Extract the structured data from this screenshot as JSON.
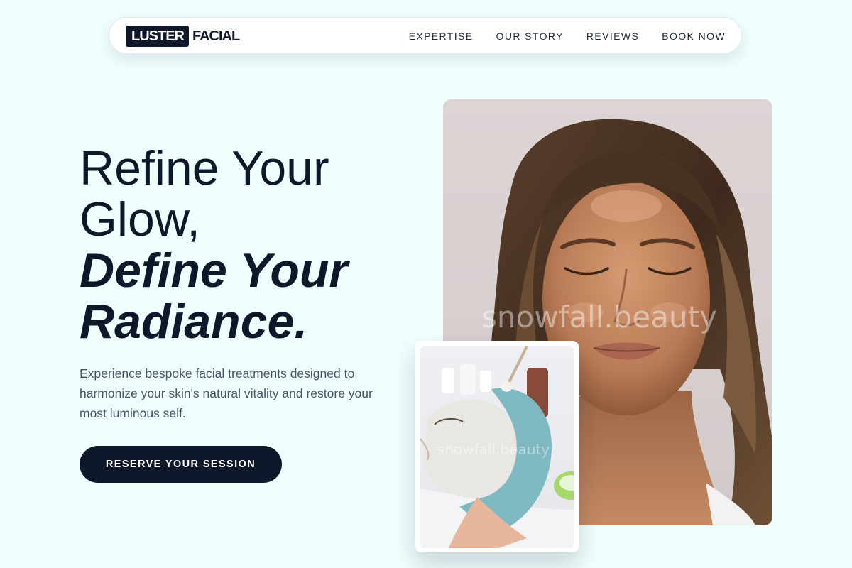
{
  "brand": {
    "logo_box": "LUSTER",
    "logo_text": "FACIAL"
  },
  "nav": {
    "links": [
      "EXPERTISE",
      "OUR STORY",
      "REVIEWS",
      "BOOK NOW"
    ]
  },
  "hero": {
    "title_line1": "Refine Your",
    "title_line2": "Glow,",
    "title_line3": "Define Your",
    "title_line4": "Radiance.",
    "description": "Experience bespoke facial treatments designed to harmonize your skin's natural vitality and restore your most luminous self.",
    "cta_label": "RESERVE YOUR SESSION"
  },
  "images": {
    "main_watermark": "snowfall.beauty",
    "sub_watermark": "snowfall.beauty"
  },
  "colors": {
    "background": "#effffe",
    "primary": "#0f172a",
    "body_text": "#475569"
  }
}
